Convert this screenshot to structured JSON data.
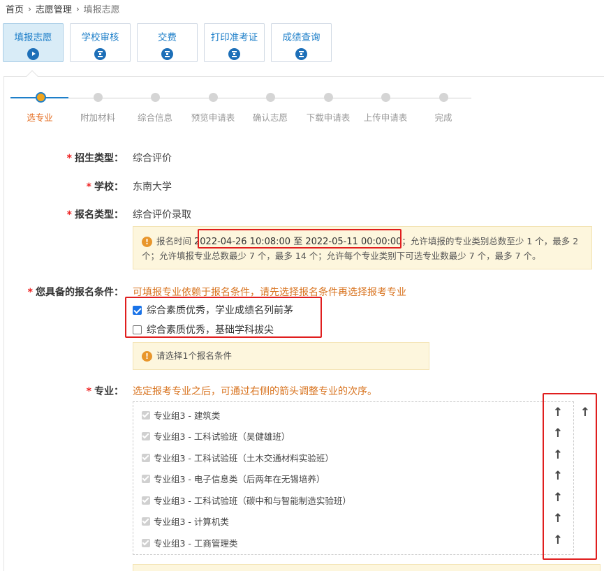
{
  "breadcrumb": {
    "home": "首页",
    "sep": "›",
    "mgmt": "志愿管理",
    "current": "填报志愿"
  },
  "tabs": [
    {
      "label": "填报志愿",
      "icon": "play-icon"
    },
    {
      "label": "学校审核",
      "icon": "hourglass-icon"
    },
    {
      "label": "交费",
      "icon": "hourglass-icon"
    },
    {
      "label": "打印准考证",
      "icon": "hourglass-icon"
    },
    {
      "label": "成绩查询",
      "icon": "hourglass-icon"
    }
  ],
  "steps": [
    "选专业",
    "附加材料",
    "综合信息",
    "预览申请表",
    "确认志愿",
    "下载申请表",
    "上传申请表",
    "完成"
  ],
  "form": {
    "enroll_type_label": "招生类型：",
    "enroll_type_value": "综合评价",
    "school_label": "学校：",
    "school_value": "东南大学",
    "apply_type_label": "报名类型：",
    "apply_type_value": "综合评价录取",
    "notice_prefix": "报名时间",
    "notice_time": "2022-04-26 10:08:00 至 2022-05-11 00:00:00",
    "notice_rest_line1": "；允许填报的专业类别总数至少 1 个，最多 2",
    "notice_line2": "个；允许填报专业总数最少 7 个，最多 14 个；允许每个专业类别下可选专业数最少 7 个，最多 7 个。",
    "condition_label": "您具备的报名条件：",
    "condition_hint": "可填报专业依赖于报名条件，请先选择报名条件再选择报考专业",
    "conditions": [
      {
        "text": "综合素质优秀，学业成绩名列前茅",
        "checked": true
      },
      {
        "text": "综合素质优秀，基础学科拔尖",
        "checked": false
      }
    ],
    "condition_notice": "请选择1个报名条件",
    "major_label": "专业：",
    "major_hint": "选定报考专业之后，可通过右侧的箭头调整专业的次序。",
    "majors": [
      "专业组3 - 建筑类",
      "专业组3 - 工科试验班（吴健雄班）",
      "专业组3 - 工科试验班（土木交通材料实验班）",
      "专业组3 - 电子信息类（后两年在无锡培养）",
      "专业组3 - 工科试验班（碳中和与智能制造实验班）",
      "专业组3 - 计算机类",
      "专业组3 - 工商管理类"
    ],
    "arrow_glyph": "↑",
    "info_glyph": "!"
  },
  "colors": {
    "accent": "#1e7fc9",
    "highlight_red": "#e01e1e",
    "orange": "#d8731f",
    "required": "#e22222"
  }
}
